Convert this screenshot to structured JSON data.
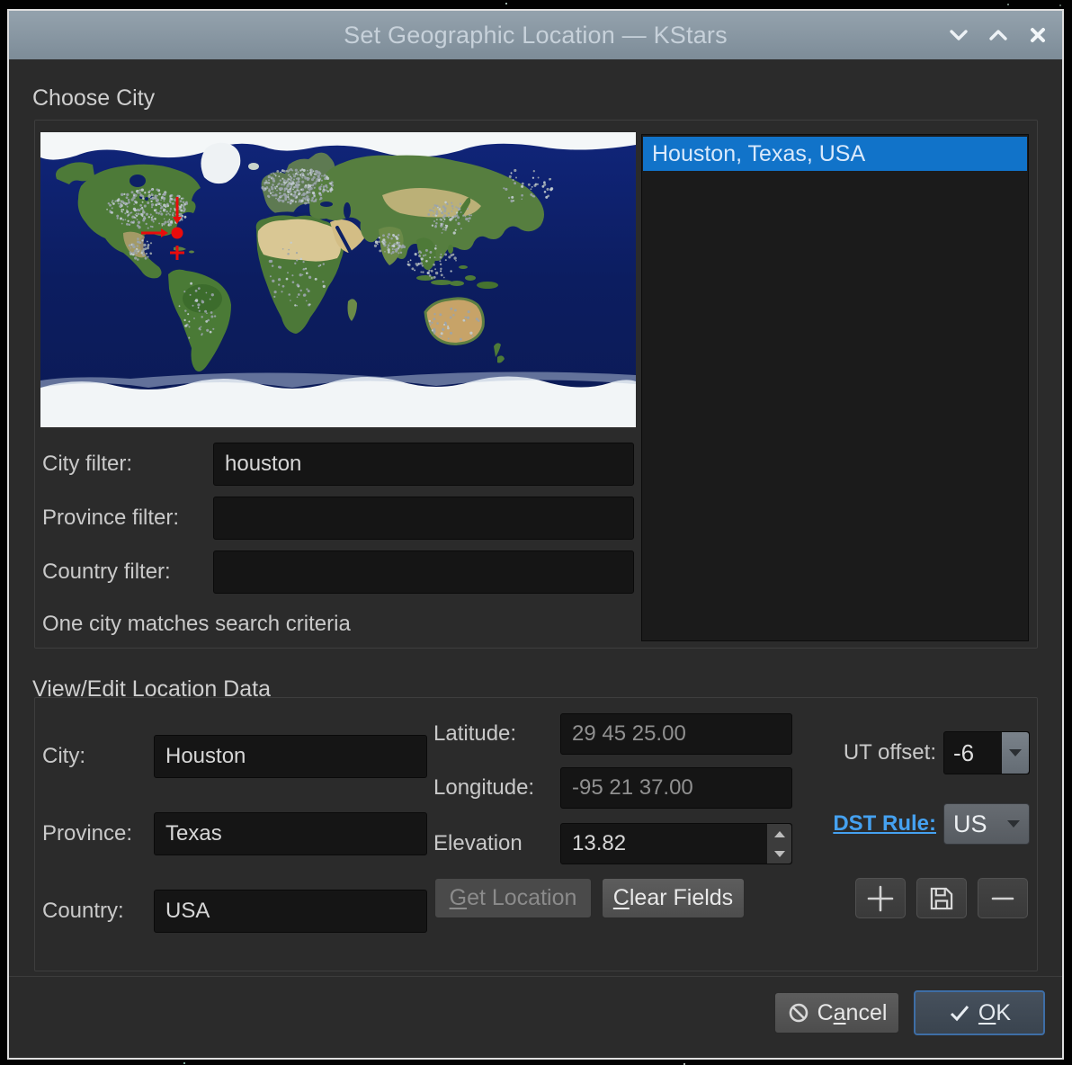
{
  "window": {
    "title": "Set Geographic Location — KStars"
  },
  "choose_city": {
    "title": "Choose City",
    "list": [
      {
        "label": "Houston, Texas, USA",
        "selected": true
      }
    ],
    "filters": {
      "city": {
        "label": "City filter:",
        "value": "houston"
      },
      "province": {
        "label": "Province filter:",
        "value": ""
      },
      "country": {
        "label": "Country filter:",
        "value": ""
      }
    },
    "status": "One city matches search criteria"
  },
  "location": {
    "title": "View/Edit Location Data",
    "city": {
      "label": "City:",
      "value": "Houston"
    },
    "province": {
      "label": "Province:",
      "value": "Texas"
    },
    "country": {
      "label": "Country:",
      "value": "USA"
    },
    "latitude": {
      "label": "Latitude:",
      "value": "29 45 25.00"
    },
    "longitude": {
      "label": "Longitude:",
      "value": "-95 21 37.00"
    },
    "elevation": {
      "label": "Elevation",
      "value": "13.82"
    },
    "ut_offset": {
      "label": "UT offset:",
      "value": "-6"
    },
    "dst_rule": {
      "label": "DST Rule:",
      "value": "US"
    },
    "get_location": {
      "pre": "",
      "accel": "G",
      "post": "et Location"
    },
    "clear_fields": {
      "pre": "",
      "accel": "C",
      "post": "lear Fields"
    }
  },
  "actions": {
    "cancel": {
      "pre": "C",
      "accel": "a",
      "post": "ncel"
    },
    "ok": {
      "pre": "",
      "accel": "O",
      "post": "K"
    }
  },
  "colors": {
    "selection": "#1173c9",
    "link": "#45a1f0",
    "ok_border": "#3e6ea6",
    "titlebar": "#8897a3"
  }
}
